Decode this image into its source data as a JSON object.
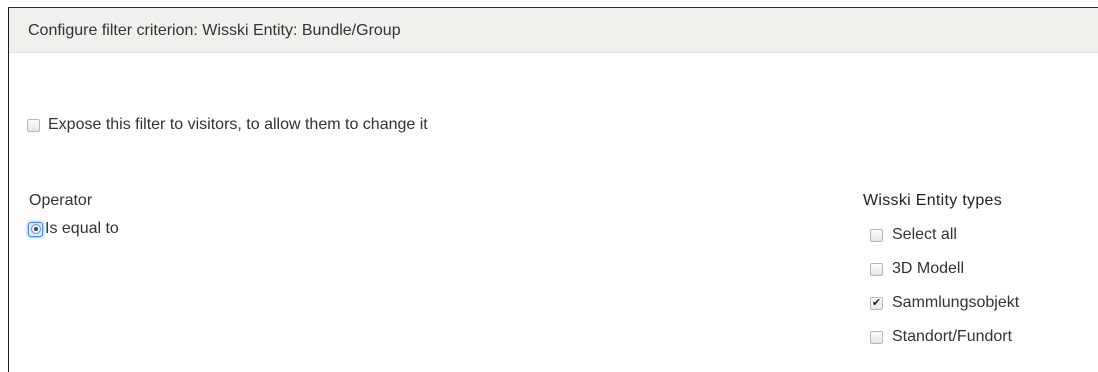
{
  "dialog": {
    "title": "Configure filter criterion: Wisski Entity: Bundle/Group"
  },
  "expose": {
    "label": "Expose this filter to visitors, to allow them to change it",
    "checked": false
  },
  "operator": {
    "label": "Operator",
    "options": [
      {
        "label": "Is equal to",
        "selected": true
      }
    ]
  },
  "entity_types": {
    "label": "Wisski Entity types",
    "items": [
      {
        "label": "Select all",
        "checked": false
      },
      {
        "label": "3D Modell",
        "checked": false
      },
      {
        "label": "Sammlungsobjekt",
        "checked": true
      },
      {
        "label": "Standort/Fundort",
        "checked": false
      }
    ]
  },
  "colors": {
    "titlebar_bg": "#f0f0ec",
    "focus_ring": "#4a90d9"
  }
}
